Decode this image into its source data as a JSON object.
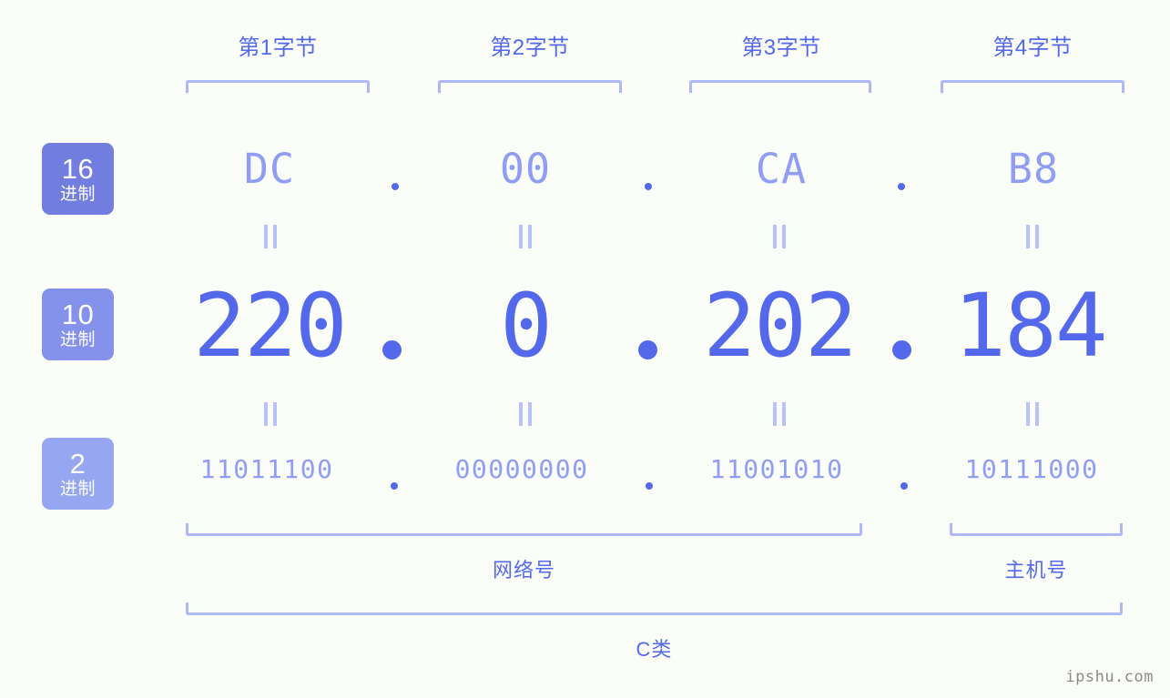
{
  "colors": {
    "background": "#fbfdf8",
    "accent_strong": "#5468ec",
    "accent_mid": "#8f9df3",
    "accent_light": "#aeb8f7",
    "badge_16": "#717ee0",
    "badge_10": "#8592ec",
    "badge_2": "#96a6f0",
    "watermark": "#8a8a8a"
  },
  "byte_headers": [
    {
      "label": "第1字节"
    },
    {
      "label": "第2字节"
    },
    {
      "label": "第3字节"
    },
    {
      "label": "第4字节"
    }
  ],
  "bases": [
    {
      "num": "16",
      "suffix": "进制",
      "color": "#717ee0"
    },
    {
      "num": "10",
      "suffix": "进制",
      "color": "#8592ec"
    },
    {
      "num": "2",
      "suffix": "进制",
      "color": "#96a6f0"
    }
  ],
  "rows": {
    "hex": {
      "base": "16",
      "values": [
        "DC",
        "00",
        "CA",
        "B8"
      ]
    },
    "dec": {
      "base": "10",
      "values": [
        "220",
        "0",
        "202",
        "184"
      ]
    },
    "bin": {
      "base": "2",
      "values": [
        "11011100",
        "00000000",
        "11001010",
        "10111000"
      ]
    }
  },
  "separators": {
    "glyph": ".",
    "count": 3
  },
  "equals": {
    "glyph": "=",
    "rotated": true,
    "per_row": 4,
    "rows": 2
  },
  "sections": {
    "network": {
      "label": "网络号",
      "spans_bytes": [
        1,
        2,
        3
      ]
    },
    "host": {
      "label": "主机号",
      "spans_bytes": [
        4
      ]
    },
    "class": {
      "label": "C类",
      "spans_bytes": [
        1,
        2,
        3,
        4
      ]
    }
  },
  "watermark": {
    "text": "ipshu.com"
  }
}
